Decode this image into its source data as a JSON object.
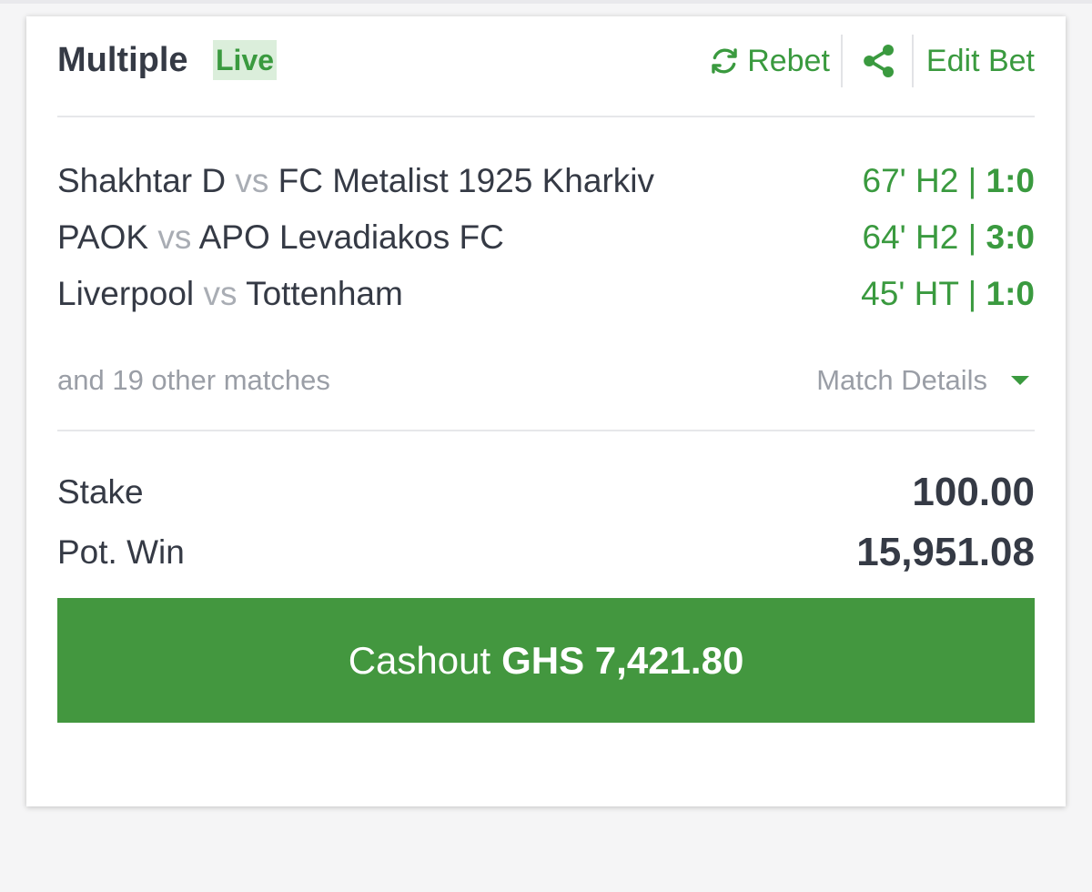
{
  "bet": {
    "title": "Multiple",
    "live_badge": "Live"
  },
  "actions": {
    "rebet_label": "Rebet",
    "edit_label": "Edit Bet"
  },
  "matches": [
    {
      "home": "Shakhtar D",
      "vs": "vs",
      "away": "FC Metalist 1925 Kharkiv",
      "time": "67' H2",
      "score": "1:0"
    },
    {
      "home": "PAOK",
      "vs": "vs",
      "away": "APO Levadiakos FC",
      "time": "64' H2",
      "score": "3:0"
    },
    {
      "home": "Liverpool",
      "vs": "vs",
      "away": "Tottenham",
      "time": "45' HT",
      "score": "1:0"
    }
  ],
  "status_separator": "|",
  "other_matches_text": "and 19 other matches",
  "match_details_label": "Match Details",
  "stake": {
    "label": "Stake",
    "value": "100.00"
  },
  "pot_win": {
    "label": "Pot. Win",
    "value": "15,951.08"
  },
  "cashout": {
    "label": "Cashout",
    "amount": "GHS 7,421.80"
  },
  "colors": {
    "accent": "#3a9a3f",
    "button": "#43973f",
    "live_bg": "#dbeedb",
    "text": "#353a45",
    "muted": "#9a9ea6"
  },
  "icons": {
    "rebet": "refresh-icon",
    "share": "share-icon",
    "details": "caret-down-icon"
  }
}
